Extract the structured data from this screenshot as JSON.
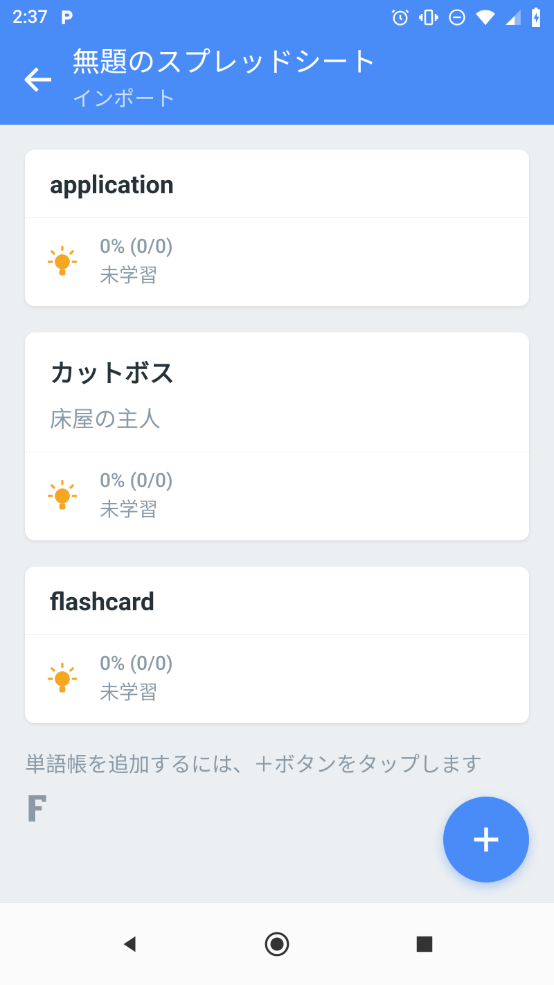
{
  "status": {
    "time": "2:37"
  },
  "header": {
    "title": "無題のスプレッドシート",
    "subtitle": "インポート"
  },
  "cards": [
    {
      "title": "application",
      "subtitle": "",
      "progress": "0% (0/0)",
      "status": "未学習"
    },
    {
      "title": "カットボス",
      "subtitle": "床屋の主人",
      "progress": "0% (0/0)",
      "status": "未学習"
    },
    {
      "title": "flashcard",
      "subtitle": "",
      "progress": "0% (0/0)",
      "status": "未学習"
    }
  ],
  "hint": "単語帳を追加するには、＋ボタンをタップします"
}
